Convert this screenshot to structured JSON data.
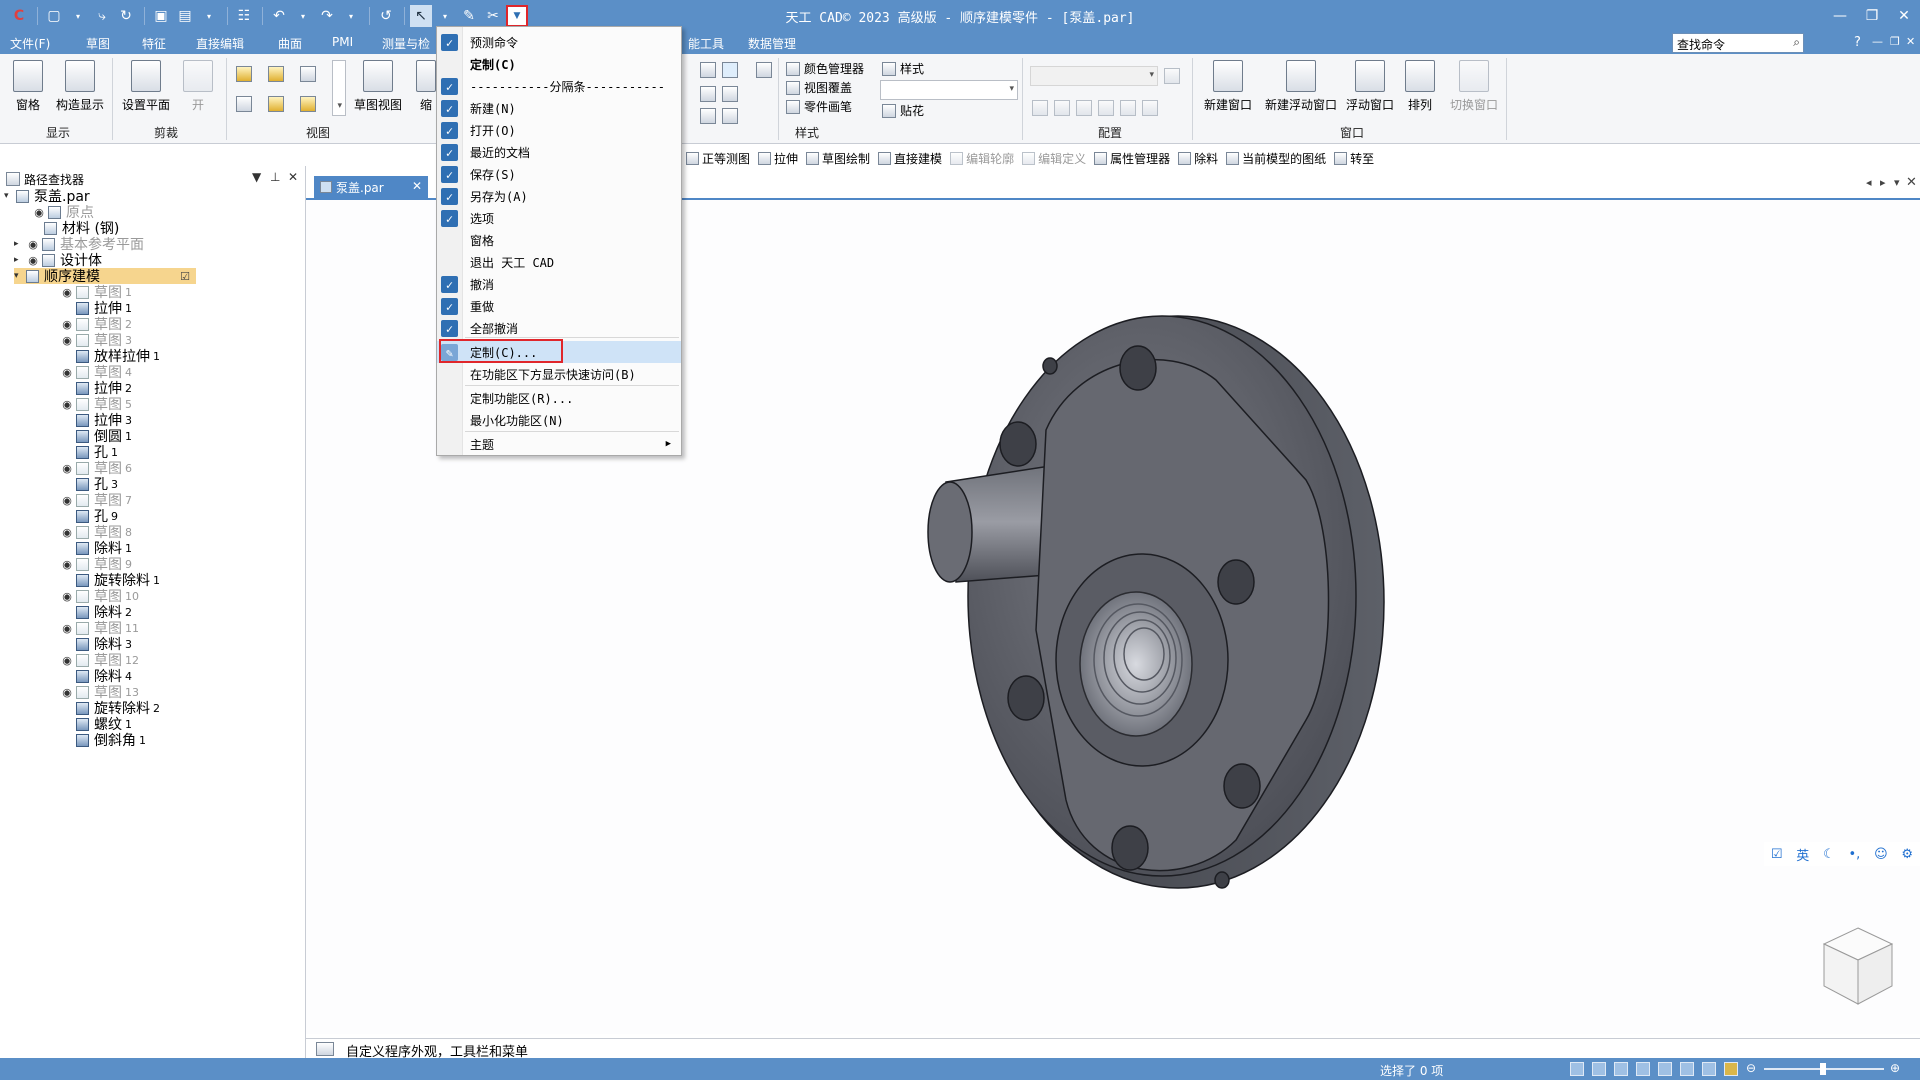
{
  "app": {
    "title": "天工 CAD© 2023 高级版 - 顺序建模零件 - [泵盖.par]"
  },
  "menubar": {
    "items": [
      "文件(F)",
      "草图",
      "特征",
      "直接编辑",
      "曲面",
      "PMI",
      "测量与检",
      "能工具",
      "数据管理"
    ],
    "search_placeholder": "查找命令"
  },
  "ribbon": {
    "groups": {
      "display": "显示",
      "clip": "剪裁",
      "view": "视图",
      "style": "样式",
      "config": "配置",
      "window": "窗口"
    },
    "buttons": {
      "pane": "窗格",
      "construct_display": "构造显示",
      "set_plane": "设置平面",
      "open": "开",
      "sketch_view": "草图视图",
      "zoom": "缩",
      "color_manager": "颜色管理器",
      "view_override": "视图覆盖",
      "part_painter": "零件画笔",
      "style": "样式",
      "decal": "贴花",
      "new_window": "新建窗口",
      "new_float_window": "新建浮动窗口",
      "float_window": "浮动窗口",
      "arrange": "排列",
      "switch_window": "切换窗口"
    }
  },
  "cmdbar": {
    "items": [
      "正等测图",
      "拉伸",
      "草图绘制",
      "直接建模",
      "编辑轮廓",
      "编辑定义",
      "属性管理器",
      "除料",
      "当前模型的图纸",
      "转至"
    ]
  },
  "panel": {
    "title": "路径查找器",
    "tree": [
      {
        "label": "泵盖.par",
        "sub": ""
      },
      {
        "label": "原点",
        "sub": ""
      },
      {
        "label": "材料 (钢)",
        "sub": ""
      },
      {
        "label": "基本参考平面",
        "sub": ""
      },
      {
        "label": "设计体",
        "sub": ""
      },
      {
        "label": "顺序建模",
        "sub": ""
      },
      {
        "label": "草图",
        "sub": "1"
      },
      {
        "label": "拉伸",
        "sub": "1"
      },
      {
        "label": "草图",
        "sub": "2"
      },
      {
        "label": "草图",
        "sub": "3"
      },
      {
        "label": "放样拉伸",
        "sub": "1"
      },
      {
        "label": "草图",
        "sub": "4"
      },
      {
        "label": "拉伸",
        "sub": "2"
      },
      {
        "label": "草图",
        "sub": "5"
      },
      {
        "label": "拉伸",
        "sub": "3"
      },
      {
        "label": "倒圆",
        "sub": "1"
      },
      {
        "label": "孔",
        "sub": "1"
      },
      {
        "label": "草图",
        "sub": "6"
      },
      {
        "label": "孔",
        "sub": "3"
      },
      {
        "label": "草图",
        "sub": "7"
      },
      {
        "label": "孔",
        "sub": "9"
      },
      {
        "label": "草图",
        "sub": "8"
      },
      {
        "label": "除料",
        "sub": "1"
      },
      {
        "label": "草图",
        "sub": "9"
      },
      {
        "label": "旋转除料",
        "sub": "1"
      },
      {
        "label": "草图",
        "sub": "10"
      },
      {
        "label": "除料",
        "sub": "2"
      },
      {
        "label": "草图",
        "sub": "11"
      },
      {
        "label": "除料",
        "sub": "3"
      },
      {
        "label": "草图",
        "sub": "12"
      },
      {
        "label": "除料",
        "sub": "4"
      },
      {
        "label": "草图",
        "sub": "13"
      },
      {
        "label": "旋转除料",
        "sub": "2"
      },
      {
        "label": "螺纹",
        "sub": "1"
      },
      {
        "label": "倒斜角",
        "sub": "1"
      }
    ]
  },
  "document": {
    "tab_label": "泵盖.par"
  },
  "popup": {
    "items": [
      {
        "label": "预测命令",
        "checked": true
      },
      {
        "label": "定制(C)",
        "checked": false,
        "bold": true
      },
      {
        "label": "-----------分隔条-----------",
        "checked": true
      },
      {
        "label": "新建(N)",
        "checked": true
      },
      {
        "label": "打开(O)",
        "checked": true
      },
      {
        "label": "最近的文档",
        "checked": true
      },
      {
        "label": "保存(S)",
        "checked": true
      },
      {
        "label": "另存为(A)",
        "checked": true
      },
      {
        "label": "选项",
        "checked": true
      },
      {
        "label": "窗格",
        "checked": false
      },
      {
        "label": "退出 天工 CAD",
        "checked": false
      },
      {
        "label": "撤消",
        "checked": true
      },
      {
        "label": "重做",
        "checked": true
      },
      {
        "label": "全部撤消",
        "checked": true
      },
      {
        "label": "定制(C)...",
        "checked": false,
        "highlight": true
      },
      {
        "label": "在功能区下方显示快速访问(B)",
        "checked": false
      },
      {
        "label": "定制功能区(R)...",
        "checked": false
      },
      {
        "label": "最小化功能区(N)",
        "checked": false
      },
      {
        "label": "主题",
        "checked": false,
        "submenu": true
      }
    ]
  },
  "ime": {
    "lang": "英"
  },
  "status": {
    "prompt": "自定义程序外观，工具栏和菜单",
    "selection": "选择了 0 项"
  },
  "colors": {
    "titlebar": "#5b8fc7",
    "accent": "#2f6fb3",
    "highlight_box": "#e0262b",
    "tree_highlight": "#f6d58e",
    "model": "#5e6068"
  }
}
